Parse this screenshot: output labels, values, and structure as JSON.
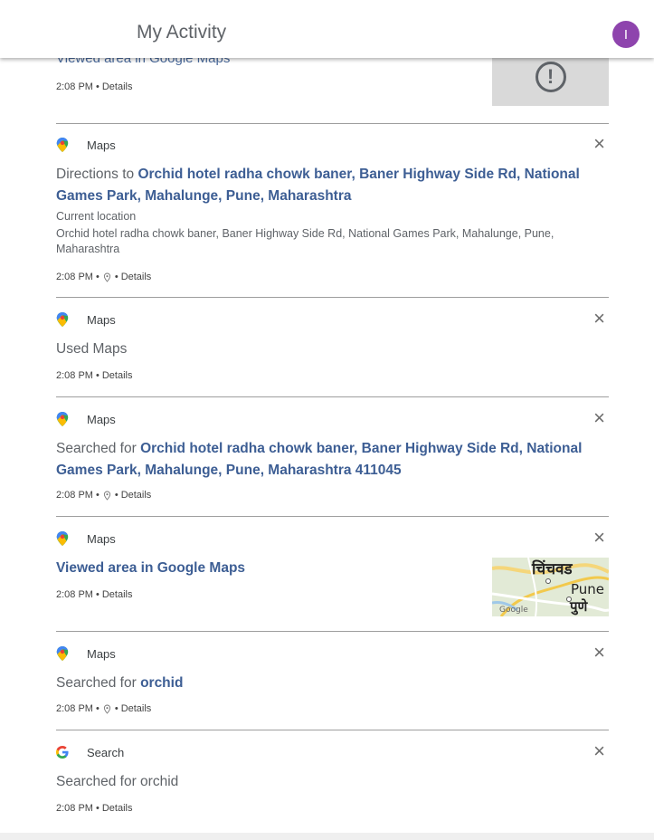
{
  "header": {
    "title": "My Activity",
    "avatar_letter": "I",
    "avatar_color": "#8e44ad"
  },
  "top_item": {
    "headline": "Viewed area in Google Maps",
    "time": "2:08 PM",
    "details": "Details",
    "thumbnail_icon": "warning-icon"
  },
  "items": [
    {
      "product": "Maps",
      "product_icon": "maps-pin-icon",
      "prefix": "Directions to ",
      "link": "Orchid hotel radha chowk baner, Baner Highway Side Rd, National Games Park, Mahalunge, Pune, Maharashtra",
      "detail_1": "Current location",
      "detail_2": "Orchid hotel radha chowk baner, Baner Highway Side Rd, National Games Park, Mahalunge, Pune, Maharashtra",
      "time": "2:08 PM",
      "details": "Details"
    },
    {
      "product": "Maps",
      "product_icon": "maps-pin-icon",
      "text": "Used Maps",
      "time": "2:08 PM",
      "details": "Details"
    },
    {
      "product": "Maps",
      "product_icon": "maps-pin-icon",
      "prefix": "Searched for ",
      "link": "Orchid hotel radha chowk baner, Baner Highway Side Rd, National Games Park, Mahalunge, Pune, Maharashtra 411045",
      "time": "2:08 PM",
      "details": "Details"
    },
    {
      "product": "Maps",
      "product_icon": "maps-pin-icon",
      "link": "Viewed area in Google Maps",
      "time": "2:08 PM",
      "details": "Details",
      "map_labels": {
        "city_devanagari": "चिंचवड",
        "city_en": "Pune",
        "city_mr": "पुणे",
        "brand": "Google"
      }
    },
    {
      "product": "Maps",
      "product_icon": "maps-pin-icon",
      "prefix": "Searched for ",
      "link": "orchid",
      "time": "2:08 PM",
      "details": "Details"
    },
    {
      "product": "Search",
      "product_icon": "google-g-icon",
      "text": "Searched for orchid",
      "time": "2:08 PM",
      "details": "Details"
    }
  ],
  "separator": "•",
  "close_glyph": "×"
}
